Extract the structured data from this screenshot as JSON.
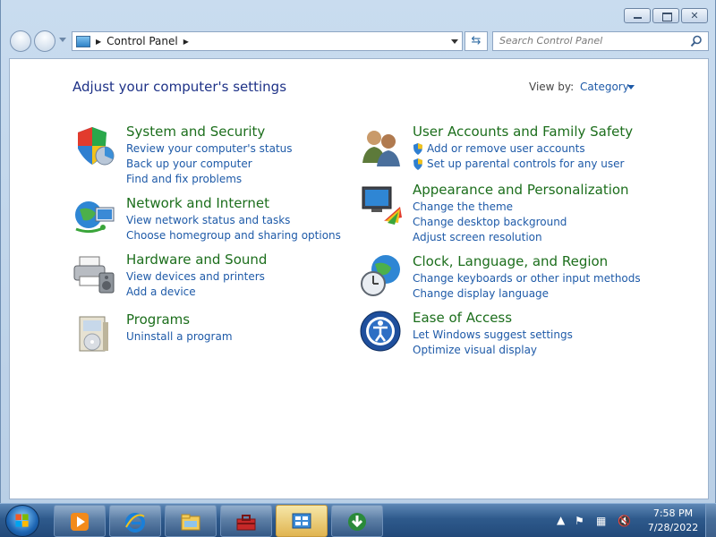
{
  "window": {
    "caption": {
      "minimize_icon": "minimize-icon",
      "maximize_icon": "maximize-icon",
      "close_glyph": "✕"
    }
  },
  "address_bar": {
    "breadcrumb": "Control Panel",
    "search_placeholder": "Search Control Panel",
    "refresh_glyph": "⇆"
  },
  "header": {
    "title": "Adjust your computer's settings",
    "view_by_label": "View by:",
    "view_by_value": "Category"
  },
  "categories": [
    {
      "title": "System and Security",
      "icon": "shield-icon",
      "links": [
        "Review your computer's status",
        "Back up your computer",
        "Find and fix problems"
      ]
    },
    {
      "title": "Network and Internet",
      "icon": "network-globe-icon",
      "links": [
        "View network status and tasks",
        "Choose homegroup and sharing options"
      ]
    },
    {
      "title": "Hardware and Sound",
      "icon": "printer-speaker-icon",
      "links": [
        "View devices and printers",
        "Add a device"
      ]
    },
    {
      "title": "Programs",
      "icon": "programs-box-icon",
      "links": [
        "Uninstall a program"
      ]
    },
    {
      "title": "User Accounts and Family Safety",
      "icon": "users-icon",
      "links": [
        "Add or remove user accounts",
        "Set up parental controls for any user"
      ]
    },
    {
      "title": "Appearance and Personalization",
      "icon": "monitor-palette-icon",
      "links": [
        "Change the theme",
        "Change desktop background",
        "Adjust screen resolution"
      ]
    },
    {
      "title": "Clock, Language, and Region",
      "icon": "clock-globe-icon",
      "links": [
        "Change keyboards or other input methods",
        "Change display language"
      ]
    },
    {
      "title": "Ease of Access",
      "icon": "ease-of-access-icon",
      "links": [
        "Let Windows suggest settings",
        "Optimize visual display"
      ]
    }
  ],
  "taskbar": {
    "clock_time": "7:58 PM",
    "clock_date": "7/28/2022"
  },
  "colors": {
    "title_blue": "#1e3287",
    "category_green": "#1c6e1c",
    "link_blue": "#1e5aa8"
  }
}
